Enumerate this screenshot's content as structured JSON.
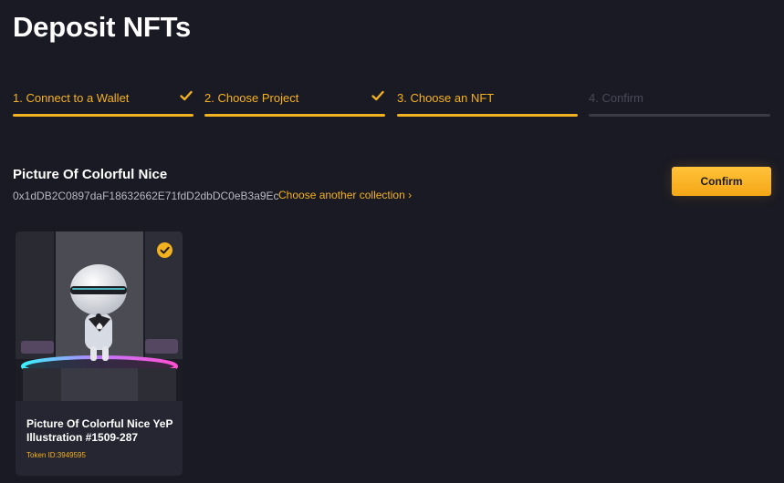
{
  "page": {
    "title": "Deposit NFTs"
  },
  "steps": [
    {
      "label": "1. Connect to a Wallet",
      "status": "done"
    },
    {
      "label": "2. Choose Project",
      "status": "done"
    },
    {
      "label": "3. Choose an NFT",
      "status": "active"
    },
    {
      "label": "4. Confirm",
      "status": "pending"
    }
  ],
  "collection": {
    "name": "Picture Of Colorful Nice",
    "address": "0x1dDB2C0897daF18632662E71fdD2dbDC0eB3a9Ec",
    "change_label": "Choose another collection",
    "change_icon": "chevron-right-icon"
  },
  "actions": {
    "confirm_label": "Confirm"
  },
  "nft": {
    "title": "Picture Of Colorful Nice YeP Illustration #1509-287",
    "token_id": "Token ID:3949595",
    "selected": true
  },
  "colors": {
    "accent": "#f2b11e",
    "background": "#1a1a24",
    "card": "#262633",
    "pending": "#3a3a47"
  }
}
